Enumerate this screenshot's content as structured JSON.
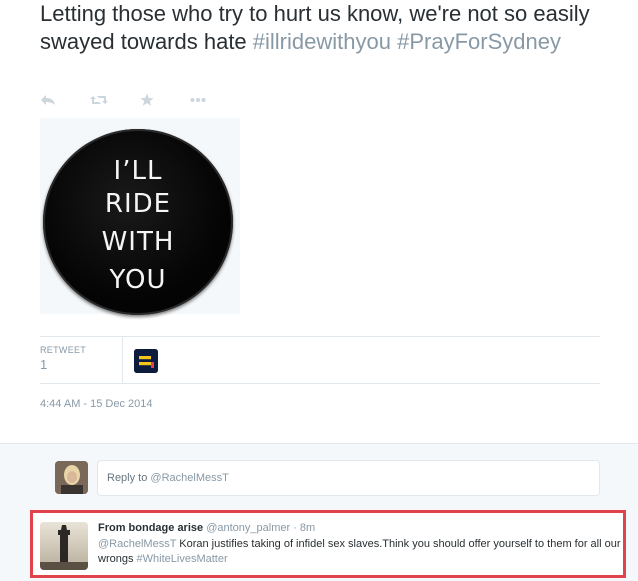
{
  "tweet": {
    "text_part1": "Letting those who try to hurt us know, we're not so easily swayed towards hate ",
    "hashtag1": "#illridewithyou",
    "hashtag2": "#PrayForSydney"
  },
  "actions": {
    "reply_icon": "reply-icon",
    "retweet_icon": "retweet-icon",
    "favorite_icon": "star-icon",
    "more_icon": "more-icon"
  },
  "badge": {
    "lines": [
      "I’LL",
      "RIDE",
      "WITH",
      "YOU"
    ]
  },
  "stats": {
    "retweet_label": "RETWEET",
    "retweet_count": "1"
  },
  "timestamp": "4:44 AM - 15 Dec 2014",
  "reply_box": {
    "prefix": "Reply to ",
    "mention": "@RachelMessT"
  },
  "reply_tweet": {
    "name": "From bondage arise",
    "handle": "@antony_palmer",
    "separator": " · ",
    "time": "8m",
    "mention": "@RachelMessT",
    "body": "  Koran justifies taking of infidel sex slaves.Think you should offer yourself to them for all our wrongs ",
    "hashtag": "#WhiteLivesMatter"
  },
  "colors": {
    "text": "#292f33",
    "muted": "#8899a6",
    "highlight_border": "#e0434a",
    "background_alt": "#f5f8fa"
  }
}
